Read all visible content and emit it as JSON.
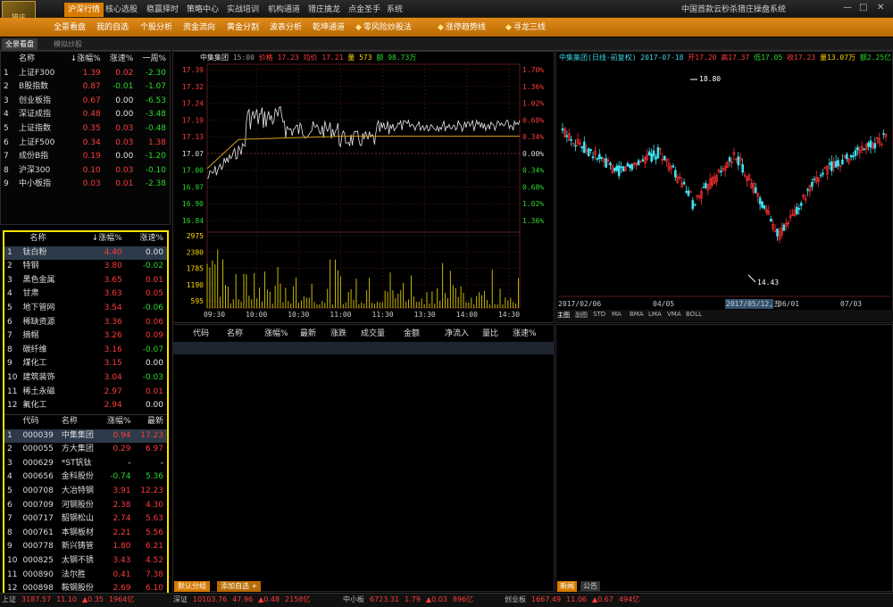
{
  "app": {
    "title": "中国首款云秒杀猎庄操盘系统",
    "logo_text": "猎庄",
    "win_min": "—",
    "win_max": "□",
    "win_close": "✕"
  },
  "menu": [
    {
      "label": "沪深行情",
      "active": true
    },
    {
      "label": "核心选股"
    },
    {
      "label": "稳赢择时"
    },
    {
      "label": "策略中心"
    },
    {
      "label": "实战培训"
    },
    {
      "label": "机构通道"
    },
    {
      "label": "猎庄擒龙"
    },
    {
      "label": "点金圣手"
    },
    {
      "label": "系统"
    }
  ],
  "toolbar": [
    {
      "label": "全景看盘"
    },
    {
      "label": "我的自选"
    },
    {
      "label": "个股分析"
    },
    {
      "label": "资金流向"
    },
    {
      "label": "黄金分割"
    },
    {
      "label": "波表分析"
    },
    {
      "label": "乾坤通道"
    },
    {
      "label": "零风险炒股法",
      "icon": "shield-icon"
    },
    {
      "label": "涨停趋势线",
      "icon": "trend-icon"
    },
    {
      "label": "寻龙三线",
      "icon": "dragon-icon"
    }
  ],
  "tabs": [
    {
      "label": "全景看盘",
      "active": true
    },
    {
      "label": "模拟炒股"
    }
  ],
  "index_table": {
    "headers": [
      "名称",
      "↓涨幅%",
      "涨速%",
      "一周%"
    ],
    "rows": [
      {
        "n": "1",
        "name": "上证F300",
        "chg": "1.39",
        "spd": "0.02",
        "week": "-2.30",
        "c1": "red",
        "c2": "red",
        "c3": "green"
      },
      {
        "n": "2",
        "name": "B股指数",
        "chg": "0.87",
        "spd": "-0.01",
        "week": "-1.07",
        "c1": "red",
        "c2": "green",
        "c3": "green"
      },
      {
        "n": "3",
        "name": "创业板指",
        "chg": "0.67",
        "spd": "0.00",
        "week": "-6.53",
        "c1": "red",
        "c2": "white",
        "c3": "green"
      },
      {
        "n": "4",
        "name": "深证成指",
        "chg": "0.48",
        "spd": "0.00",
        "week": "-3.48",
        "c1": "red",
        "c2": "white",
        "c3": "green"
      },
      {
        "n": "5",
        "name": "上证指数",
        "chg": "0.35",
        "spd": "0.03",
        "week": "-0.48",
        "c1": "red",
        "c2": "red",
        "c3": "green"
      },
      {
        "n": "6",
        "name": "上证F500",
        "chg": "0.34",
        "spd": "0.03",
        "week": "1.38",
        "c1": "red",
        "c2": "red",
        "c3": "red"
      },
      {
        "n": "7",
        "name": "成份B指",
        "chg": "0.19",
        "spd": "0.00",
        "week": "-1.20",
        "c1": "red",
        "c2": "white",
        "c3": "green"
      },
      {
        "n": "8",
        "name": "沪深300",
        "chg": "0.10",
        "spd": "0.03",
        "week": "-0.10",
        "c1": "red",
        "c2": "red",
        "c3": "green"
      },
      {
        "n": "9",
        "name": "中小板指",
        "chg": "0.03",
        "spd": "0.01",
        "week": "-2.38",
        "c1": "red",
        "c2": "red",
        "c3": "green"
      }
    ]
  },
  "sector_table": {
    "headers": [
      "名称",
      "↓涨幅%",
      "涨速%"
    ],
    "rows": [
      {
        "n": "1",
        "name": "钛白粉",
        "chg": "4.40",
        "spd": "0.00",
        "c1": "red",
        "c2": "white"
      },
      {
        "n": "2",
        "name": "特钢",
        "chg": "3.80",
        "spd": "-0.02",
        "c1": "red",
        "c2": "green"
      },
      {
        "n": "3",
        "name": "黑色金属",
        "chg": "3.65",
        "spd": "0.01",
        "c1": "red",
        "c2": "red"
      },
      {
        "n": "4",
        "name": "甘肃",
        "chg": "3.63",
        "spd": "0.05",
        "c1": "red",
        "c2": "red"
      },
      {
        "n": "5",
        "name": "地下管网",
        "chg": "3.54",
        "spd": "-0.06",
        "c1": "red",
        "c2": "green"
      },
      {
        "n": "6",
        "name": "稀缺资源",
        "chg": "3.36",
        "spd": "0.06",
        "c1": "red",
        "c2": "red"
      },
      {
        "n": "7",
        "name": "摘帽",
        "chg": "3.26",
        "spd": "0.09",
        "c1": "red",
        "c2": "red"
      },
      {
        "n": "8",
        "name": "碳纤维",
        "chg": "3.16",
        "spd": "-0.07",
        "c1": "red",
        "c2": "green"
      },
      {
        "n": "9",
        "name": "煤化工",
        "chg": "3.15",
        "spd": "0.00",
        "c1": "red",
        "c2": "white"
      },
      {
        "n": "10",
        "name": "建筑装饰",
        "chg": "3.04",
        "spd": "-0.03",
        "c1": "red",
        "c2": "green"
      },
      {
        "n": "11",
        "name": "稀土永磁",
        "chg": "2.97",
        "spd": "0.01",
        "c1": "red",
        "c2": "red"
      },
      {
        "n": "12",
        "name": "氟化工",
        "chg": "2.94",
        "spd": "0.00",
        "c1": "red",
        "c2": "white"
      }
    ]
  },
  "stock_table": {
    "headers": [
      "代码",
      "名称",
      "涨幅%",
      "最新"
    ],
    "rows": [
      {
        "n": "1",
        "code": "000039",
        "name": "中集集团",
        "chg": "0.94",
        "last": "17.23",
        "c1": "red",
        "c2": "red"
      },
      {
        "n": "2",
        "code": "000055",
        "name": "方大集团",
        "chg": "0.29",
        "last": "6.97",
        "c1": "red",
        "c2": "red"
      },
      {
        "n": "3",
        "code": "000629",
        "name": "*ST钒钛",
        "chg": "-",
        "last": "-",
        "c1": "white",
        "c2": "white"
      },
      {
        "n": "4",
        "code": "000656",
        "name": "金科股份",
        "chg": "-0.74",
        "last": "5.36",
        "c1": "green",
        "c2": "green"
      },
      {
        "n": "5",
        "code": "000708",
        "name": "大冶特钢",
        "chg": "3.91",
        "last": "12.23",
        "c1": "red",
        "c2": "red"
      },
      {
        "n": "6",
        "code": "000709",
        "name": "河钢股份",
        "chg": "2.38",
        "last": "4.30",
        "c1": "red",
        "c2": "red"
      },
      {
        "n": "7",
        "code": "000717",
        "name": "韶钢松山",
        "chg": "2.74",
        "last": "5.63",
        "c1": "red",
        "c2": "red"
      },
      {
        "n": "8",
        "code": "000761",
        "name": "本钢板材",
        "chg": "2.21",
        "last": "5.56",
        "c1": "red",
        "c2": "red"
      },
      {
        "n": "9",
        "code": "000778",
        "name": "新兴铸管",
        "chg": "1.80",
        "last": "6.21",
        "c1": "red",
        "c2": "red"
      },
      {
        "n": "10",
        "code": "000825",
        "name": "太钢不锈",
        "chg": "3.43",
        "last": "4.52",
        "c1": "red",
        "c2": "red"
      },
      {
        "n": "11",
        "code": "000890",
        "name": "法尔胜",
        "chg": "0.41",
        "last": "7.38",
        "c1": "red",
        "c2": "red"
      },
      {
        "n": "12",
        "code": "000898",
        "name": "鞍钢股份",
        "chg": "2.69",
        "last": "6.10",
        "c1": "red",
        "c2": "red"
      }
    ]
  },
  "intraday": {
    "name": "中集集团",
    "time": "15:00",
    "price_label": "价格",
    "price": "17.23",
    "avg_label": "均价",
    "avg": "17.21",
    "vol_label": "量",
    "vol": "573",
    "amt_label": "额",
    "amt": "98.73万",
    "price_ticks": [
      "17.39",
      "17.32",
      "17.24",
      "17.19",
      "17.13",
      "17.07",
      "17.00",
      "16.97",
      "16.90",
      "16.84"
    ],
    "pct_ticks": [
      "1.70%",
      "1.36%",
      "1.02%",
      "0.68%",
      "0.34%",
      "0.00%",
      "0.34%",
      "0.68%",
      "1.02%",
      "1.36%"
    ],
    "vol_ticks": [
      "2975",
      "2380",
      "1785",
      "1190",
      "595"
    ],
    "time_ticks": [
      "09:30",
      "10:00",
      "10:30",
      "11:00",
      "11:30",
      "13:30",
      "14:00",
      "14:30"
    ]
  },
  "kline": {
    "title": "中集集团(日线-前复权) 2017-07-18",
    "open_label": "开",
    "open": "17.20",
    "high_label": "高",
    "high": "17.37",
    "low_label": "低",
    "low": "17.05",
    "close_label": "收",
    "close": "17.23",
    "vol_label": "量",
    "vol": "13.07万",
    "amt_label": "额",
    "amt": "2.25亿",
    "high_mark": "18.80",
    "low_mark": "14.43",
    "date_ticks": [
      "2017/02/06",
      "04/05",
      "2017/05/12,五",
      "06/01",
      "07/03"
    ],
    "indicators": [
      "主图",
      "副图",
      "STD",
      "MA",
      "BMA",
      "LMA",
      "VMA",
      "BOLL"
    ]
  },
  "quote_table": {
    "headers": [
      "代码",
      "名称",
      "涨幅%",
      "最新",
      "涨跌",
      "成交量",
      "金额",
      "净流入",
      "量比",
      "涨速%"
    ]
  },
  "bottom_tabs": {
    "default_group": "默认分组",
    "add_watch": "添加自选 +",
    "news": "新闻",
    "notice": "公告"
  },
  "status_bar": [
    {
      "name": "上证",
      "price": "3187.57",
      "chg": "11.10",
      "pct": "0.35",
      "amt": "1964亿"
    },
    {
      "name": "深证",
      "price": "10103.76",
      "chg": "47.96",
      "pct": "0.48",
      "amt": "2158亿"
    },
    {
      "name": "中小板",
      "price": "6723.31",
      "chg": "1.79",
      "pct": "0.03",
      "amt": "896亿"
    },
    {
      "name": "创业板",
      "price": "1667.49",
      "chg": "11.06",
      "pct": "0.67",
      "amt": "494亿"
    }
  ],
  "colors": {
    "accent": "#d77a00",
    "up": "#ff3b3b",
    "down": "#2bd82b",
    "highlight_box": "#ffe400"
  }
}
